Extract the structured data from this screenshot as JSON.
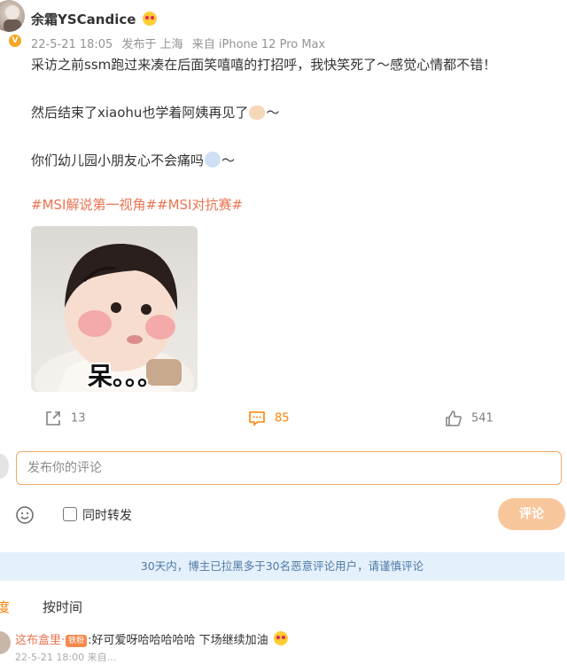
{
  "post": {
    "username": "余霜YSCandice",
    "verified_badge": "V",
    "meta": {
      "date": "22-5-21 18:05",
      "location": "发布于 上海",
      "device": "来自 iPhone 12 Pro Max"
    },
    "lines": [
      "采访之前ssm跑过来凑在后面笑嘻嘻的打招呼，我快笑死了～感觉心情都不错！",
      "然后结束了xiaohu也学着阿姨再见了",
      "～",
      "你们幼儿园小朋友心不会痛吗",
      "～"
    ],
    "topics": "#MSI解说第一视角##MSI对抗赛#",
    "image_caption": "呆。。。"
  },
  "actions": {
    "repost_count": "13",
    "comment_count": "85",
    "like_count": "541",
    "comment_active_color": "#ff8200"
  },
  "composer": {
    "placeholder": "发布你的评论",
    "repost_label": "同时转发",
    "submit_label": "评论"
  },
  "notice": "30天内，博主已拉黑多于30名恶意评论用户，请谨慎评论",
  "sort": {
    "option_a": "度",
    "option_b": "按时间"
  },
  "comment": {
    "user": "这布盒里·",
    "badge": "铁粉",
    "text": ":好可爱呀哈哈哈哈哈 下场继续加油",
    "meta": "22-5-21 18:00  来自..."
  },
  "colors": {
    "accent": "#ff8200",
    "link": "#eb7350",
    "notice_bg": "#e4f0fb",
    "notice_text": "#4e79a5",
    "submit_disabled": "#f8c69b"
  }
}
